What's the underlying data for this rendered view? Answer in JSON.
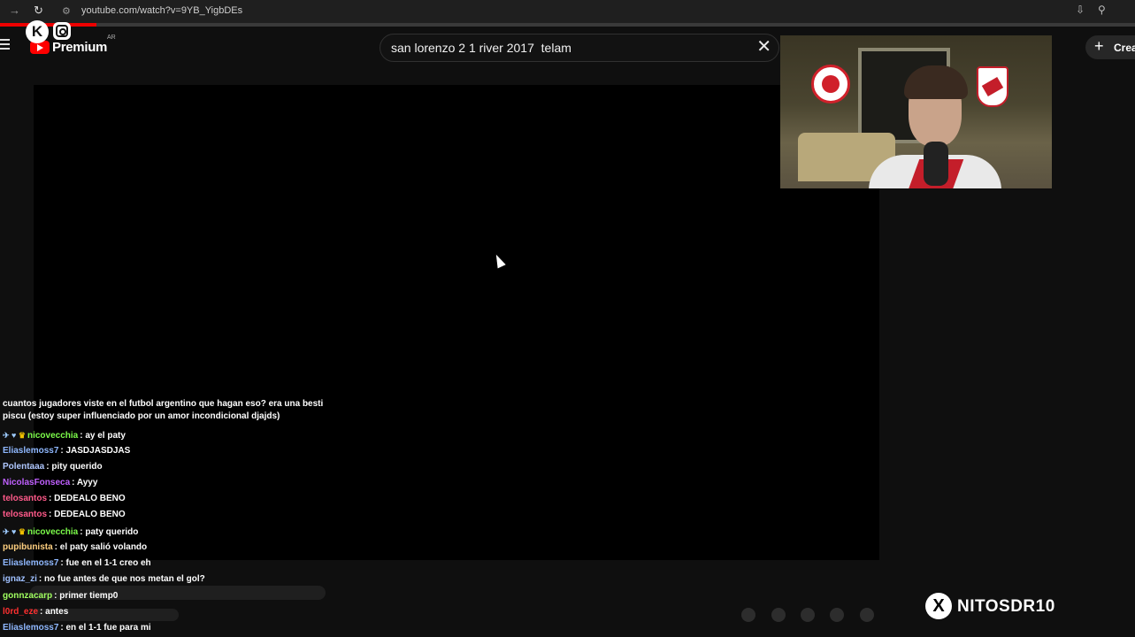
{
  "browser": {
    "url": "youtube.com/watch?v=9YB_YigbDEs",
    "icons": [
      "back-arrow-icon",
      "reload-icon",
      "site-settings-icon",
      "install-app-icon",
      "zoom-icon"
    ]
  },
  "header": {
    "brand": "Premium",
    "region": "AR",
    "search_value": "san lorenzo 2 1 river 2017  telam",
    "create_label": "Crea"
  },
  "colors": {
    "accent": "#ff0000",
    "background": "#0f0f0f"
  },
  "chat": [
    {
      "user": "",
      "color": "#ffffff",
      "text": "cuantos jugadores viste en el futbol argentino que hagan eso? era una besti piscu (estoy super influenciado por un amor incondicional djajds)",
      "badges": false
    },
    {
      "user": "nicovecchia",
      "color": "#7cfc4a",
      "text": ": ay el paty",
      "badges": true
    },
    {
      "user": "Eliaslemoss7",
      "color": "#8fb8ff",
      "text": ": JASDJASDJAS",
      "badges": false
    },
    {
      "user": "Polentaaa",
      "color": "#b0c8ff",
      "text": ": pity querido",
      "badges": false
    },
    {
      "user": "NicolasFonseca",
      "color": "#c060ff",
      "text": ": Ayyy",
      "badges": false
    },
    {
      "user": "telosantos",
      "color": "#ff5a8a",
      "text": ": DEDEALO BENO",
      "badges": false
    },
    {
      "user": "telosantos",
      "color": "#ff5a8a",
      "text": ": DEDEALO BENO",
      "badges": false
    },
    {
      "user": "nicovecchia",
      "color": "#7cfc4a",
      "text": ": paty querido",
      "badges": true
    },
    {
      "user": "pupibunista",
      "color": "#ffd080",
      "text": ": el paty salió volando",
      "badges": false
    },
    {
      "user": "Eliaslemoss7",
      "color": "#8fb8ff",
      "text": ": fue en el 1-1 creo eh",
      "badges": false
    },
    {
      "user": "ignaz_zi",
      "color": "#9fc0ff",
      "text": ": no fue antes de que nos metan el gol?",
      "badges": false
    },
    {
      "user": "gonnzacarp",
      "color": "#a0ff60",
      "text": ": primer tiemp0",
      "badges": false
    },
    {
      "user": "l0rd_eze",
      "color": "#ff3030",
      "text": ": antes",
      "badges": false
    },
    {
      "user": "Eliaslemoss7",
      "color": "#8fb8ff",
      "text": ": en el 1-1 fue para mi",
      "badges": false
    }
  ],
  "social": {
    "handle": "NITOSDR10"
  }
}
